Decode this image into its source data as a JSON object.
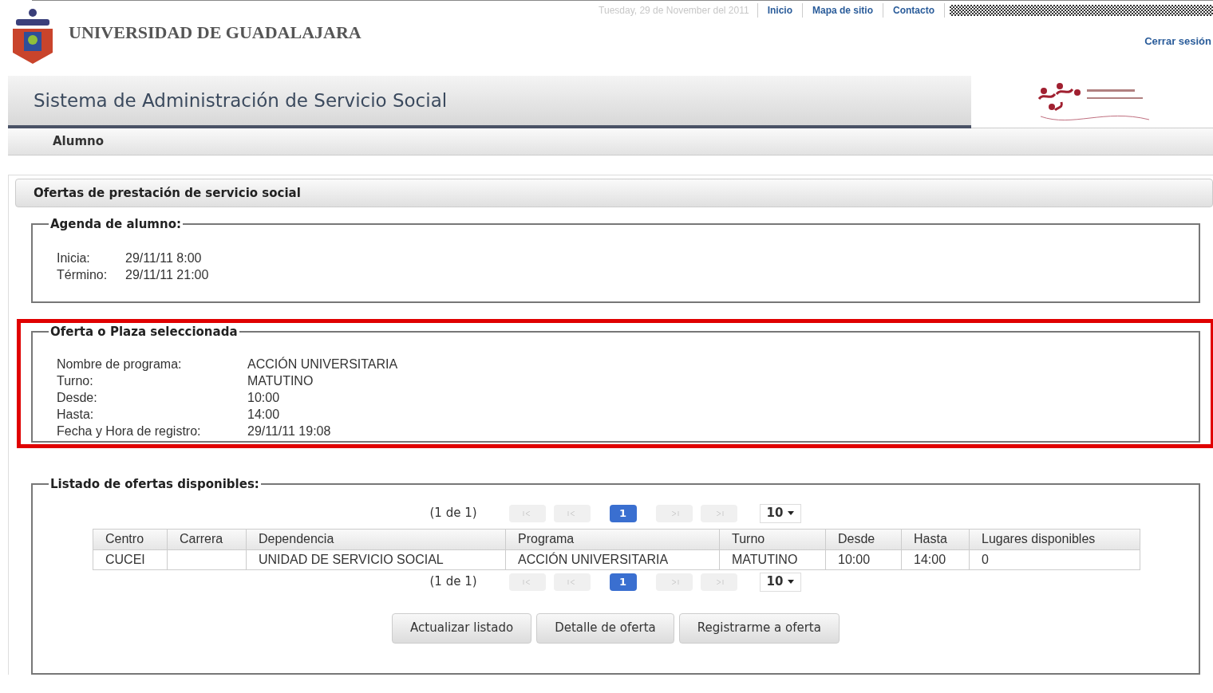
{
  "top_bar": {
    "date": "Tuesday, 29 de November del 2011",
    "links": [
      "Inicio",
      "Mapa de sitio",
      "Contacto"
    ]
  },
  "header": {
    "university": "UNIVERSIDAD DE GUADALAJARA",
    "logout": "Cerrar sesión"
  },
  "title_bar": {
    "title": "Sistema de Administración de Servicio Social"
  },
  "menu": {
    "items": [
      "Alumno"
    ]
  },
  "section": {
    "title": "Ofertas de prestación de servicio social"
  },
  "agenda": {
    "legend": "Agenda de alumno:",
    "fields": [
      {
        "label": "Inicia:",
        "value": "29/11/11 8:00"
      },
      {
        "label": "Término:",
        "value": "29/11/11 21:00"
      }
    ]
  },
  "selected_offer": {
    "legend": "Oferta o Plaza seleccionada",
    "highlighted": true,
    "fields": [
      {
        "label": "Nombre de programa:",
        "value": "ACCIÓN UNIVERSITARIA"
      },
      {
        "label": "Turno:",
        "value": "MATUTINO"
      },
      {
        "label": "Desde:",
        "value": "10:00"
      },
      {
        "label": "Hasta:",
        "value": "14:00"
      },
      {
        "label": "Fecha y Hora de registro:",
        "value": "29/11/11 19:08"
      }
    ]
  },
  "listing": {
    "legend": "Listado de ofertas disponibles:",
    "pager_top": {
      "summary": "(1 de 1)",
      "pages": [
        {
          "label": "1",
          "selected": true
        }
      ],
      "page_size": "10"
    },
    "table": {
      "columns": [
        "Centro",
        "Carrera",
        "Dependencia",
        "Programa",
        "Turno",
        "Desde",
        "Hasta",
        "Lugares disponibles"
      ],
      "rows": [
        [
          "CUCEI",
          "",
          "UNIDAD DE SERVICIO SOCIAL",
          "ACCIÓN UNIVERSITARIA",
          "MATUTINO",
          "10:00",
          "14:00",
          "0"
        ]
      ]
    },
    "pager_bottom": {
      "summary": "(1 de 1)",
      "pages": [
        {
          "label": "1",
          "selected": true
        }
      ],
      "page_size": "10"
    },
    "buttons": [
      "Actualizar listado",
      "Detalle de oferta",
      "Registrarme a oferta"
    ]
  }
}
